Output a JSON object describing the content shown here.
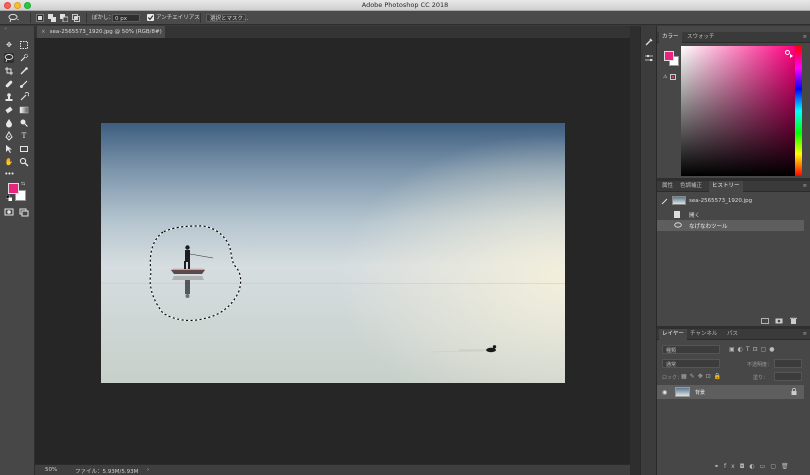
{
  "window": {
    "title": "Adobe Photoshop CC 2018"
  },
  "options": {
    "feather_label": "ぼかし：",
    "feather_value": "0 px",
    "antialias_label": "アンチエイリアス",
    "select_mask_button": "選択とマスク..."
  },
  "document": {
    "tab_label": "sea-2565573_1920.jpg @ 50% (RGB/8#)"
  },
  "status": {
    "zoom": "50%",
    "file_info": "ファイル：5.93M/5.93M",
    "arrow": "›"
  },
  "color_panel": {
    "tabs": [
      "カラー",
      "スウォッチ"
    ],
    "foreground": "#e8247c",
    "background": "#ffffff",
    "hue": "#ff0080"
  },
  "history_panel": {
    "tabs": [
      "属性",
      "色調補正",
      "ヒストリー"
    ],
    "snapshot": "sea-2565573_1920.jpg",
    "items": [
      "開く",
      "なげなわツール"
    ]
  },
  "layers_panel": {
    "tabs": [
      "レイヤー",
      "チャンネル",
      "パス"
    ],
    "filter_label": "種類",
    "blend_mode": "通常",
    "opacity_label": "不透明度：",
    "lock_label": "ロック：",
    "fill_label": "塗り：",
    "layer_name": "背景"
  }
}
